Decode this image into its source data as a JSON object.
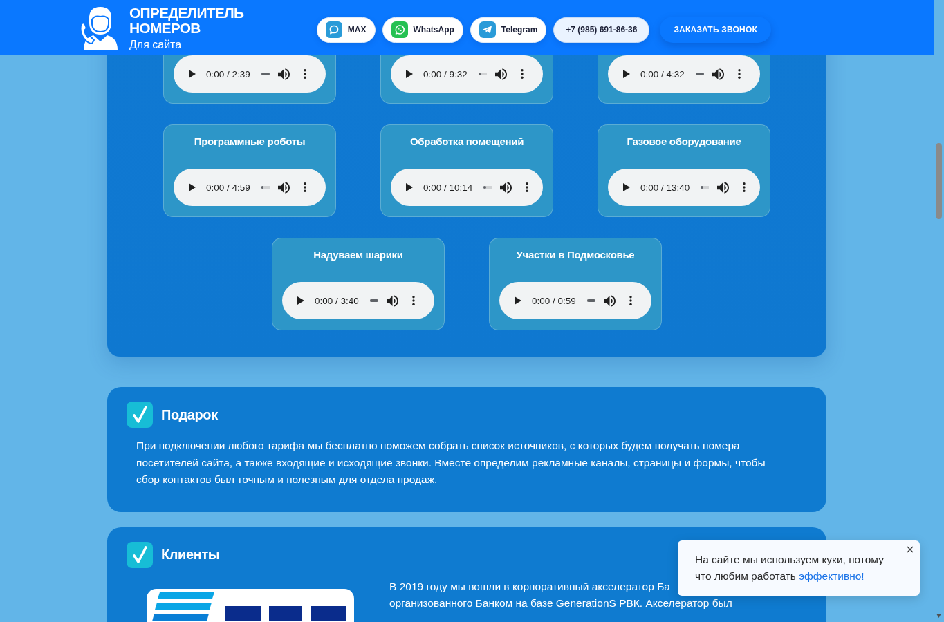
{
  "header": {
    "title": "ОПРЕДЕЛИТЕЛЬ НОМЕРОВ",
    "subtitle": "Для сайта",
    "contacts": [
      {
        "kind": "max",
        "label": "MAX"
      },
      {
        "kind": "whatsapp",
        "label": "WhatsApp"
      },
      {
        "kind": "telegram",
        "label": "Telegram"
      },
      {
        "kind": "phone",
        "label": "+7 (985) 691-86-36"
      }
    ],
    "cta": "ЗАКАЗАТЬ ЗВОНОК"
  },
  "audio_samples": [
    {
      "time": "0:00 / 2:39",
      "level": 1
    },
    {
      "time": "0:00 / 9:32",
      "level": 0.3
    },
    {
      "time": "0:00 / 4:32",
      "level": 1
    },
    {
      "title": "Программные роботы",
      "time": "0:00 / 4:59",
      "level": 0.3
    },
    {
      "title": "Обработка помещений",
      "time": "0:00 / 10:14",
      "level": 0.3
    },
    {
      "title": "Газовое оборудование",
      "time": "0:00 / 13:40",
      "level": 0.3
    },
    {
      "title": "Надуваем шарики",
      "time": "0:00 / 3:40",
      "level": 1
    },
    {
      "title": "Участки в Подмосковье",
      "time": "0:00 / 0:59",
      "level": 1
    }
  ],
  "gift": {
    "title": "Подарок",
    "text": "При подключении любого тарифа мы бесплатно поможем собрать список источников, с которых будем получать номера посетителей сайта, а также входящие и исходящие звонки. Вместе определим рекламные каналы, страницы и формы, чтобы сбор контактов был точным и полезным для отдела продаж."
  },
  "clients": {
    "title": "Клиенты",
    "text_lines": [
      "В 2019 году мы вошли в корпоративный акселератор Ба",
      "организованного Банком на базе GenerationS РВК. Акселератор был"
    ]
  },
  "cookie_notice": {
    "text": "На сайте мы используем куки, потому что любим работать",
    "link": "эффективно!"
  }
}
